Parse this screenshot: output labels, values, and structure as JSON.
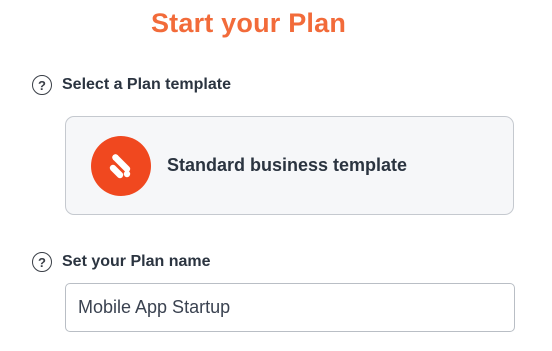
{
  "title": "Start your Plan",
  "template_section": {
    "label": "Select a Plan template",
    "help_icon": "question-circle-icon",
    "selected_template": {
      "name": "Standard business template",
      "logo_icon": "brand-slash-logo",
      "logo_color": "#f0481f"
    }
  },
  "name_section": {
    "label": "Set your Plan name",
    "help_icon": "question-circle-icon",
    "input_value": "Mobile App Startup"
  },
  "colors": {
    "accent": "#f26b3a",
    "text": "#2b3440"
  }
}
